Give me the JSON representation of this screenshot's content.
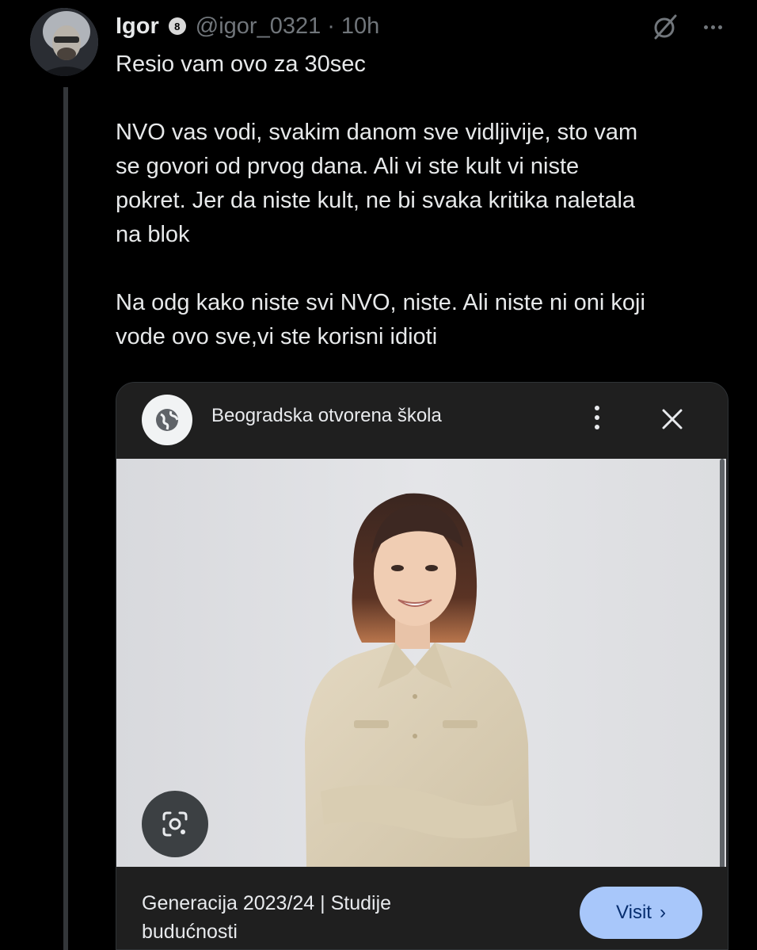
{
  "tweet": {
    "author_name": "Igor",
    "badge_text": "8",
    "handle": "@igor_0321",
    "separator": "·",
    "time": "10h",
    "paragraphs": [
      "Resio vam ovo za 30sec",
      "NVO vas vodi, svakim danom sve vidljivije, sto vam\nse govori od prvog dana. Ali vi ste kult vi niste\npokret. Jer da niste kult, ne bi svaka kritika naletala\nna blok",
      "Na odg kako niste svi NVO, niste. Ali niste ni oni koji\nvode ovo sve,vi ste korisni idioti"
    ]
  },
  "icons": {
    "grok": "grok-icon",
    "more": "more-horizontal-icon",
    "globe": "globe-icon",
    "kebab": "more-vertical-icon",
    "close": "close-icon",
    "lens": "google-lens-icon",
    "chevron": "chevron-right-icon"
  },
  "card": {
    "site_name": "Beogradska otvorena škola",
    "result_title": "Generacija 2023/24 | Studije budućnosti",
    "visit_label": "Visit",
    "visit_chevron": "›"
  },
  "colors": {
    "background": "#000000",
    "text": "#e7e9ea",
    "muted": "#71767b",
    "card_bg": "#1f1f1f",
    "visit_button": "#a8c7fa",
    "visit_text": "#062e6f"
  }
}
